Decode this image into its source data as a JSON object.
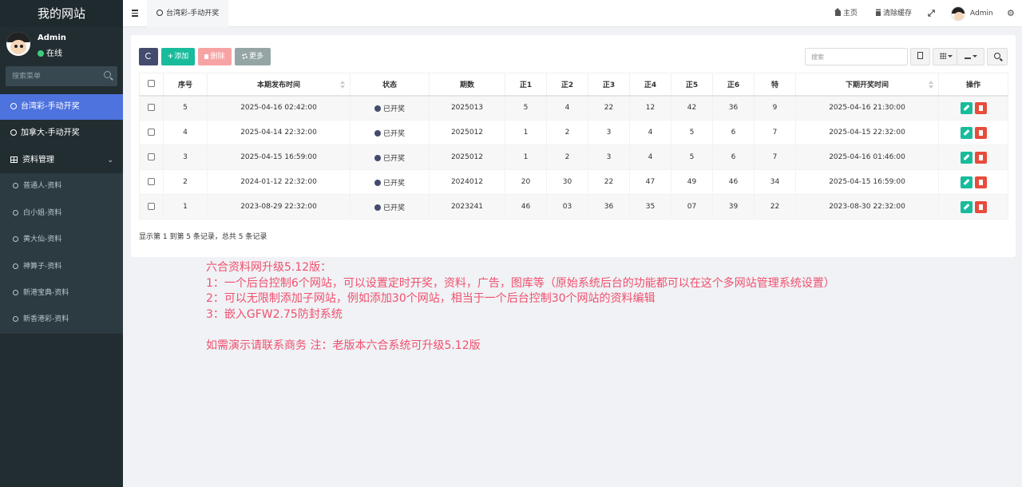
{
  "sidebar": {
    "logo": "我的网站",
    "user": {
      "name": "Admin",
      "status": "在线"
    },
    "search_placeholder": "搜索菜单",
    "items": [
      {
        "label": "台湾彩-手动开奖",
        "active": true
      },
      {
        "label": "加拿大-手动开奖",
        "active": false
      }
    ],
    "group": {
      "label": "资料管理",
      "children": [
        "普通人-资料",
        "白小姐-资料",
        "黄大仙-资料",
        "神算子-资料",
        "新港宝典-资料",
        "新香港彩-资料"
      ]
    }
  },
  "header": {
    "tab": "台湾彩-手动开奖",
    "home": "主页",
    "clear_cache": "清除缓存",
    "admin": "Admin"
  },
  "toolbar": {
    "add": "添加",
    "delete": "删除",
    "more": "更多",
    "search_placeholder": "搜索"
  },
  "table": {
    "columns": [
      "序号",
      "本期发布时间",
      "状态",
      "期数",
      "正1",
      "正2",
      "正3",
      "正4",
      "正5",
      "正6",
      "特",
      "下期开奖时间",
      "操作"
    ],
    "rows": [
      [
        "5",
        "2025-04-16 02:42:00",
        "已开奖",
        "2025013",
        "5",
        "4",
        "22",
        "12",
        "42",
        "36",
        "9",
        "2025-04-16 21:30:00"
      ],
      [
        "4",
        "2025-04-14 22:32:00",
        "已开奖",
        "2025012",
        "1",
        "2",
        "3",
        "4",
        "5",
        "6",
        "7",
        "2025-04-15 22:32:00"
      ],
      [
        "3",
        "2025-04-15 16:59:00",
        "已开奖",
        "2025012",
        "1",
        "2",
        "3",
        "4",
        "5",
        "6",
        "7",
        "2025-04-16 01:46:00"
      ],
      [
        "2",
        "2024-01-12 22:32:00",
        "已开奖",
        "2024012",
        "20",
        "30",
        "22",
        "47",
        "49",
        "46",
        "34",
        "2025-04-15 16:59:00"
      ],
      [
        "1",
        "2023-08-29 22:32:00",
        "已开奖",
        "2023241",
        "46",
        "03",
        "36",
        "35",
        "07",
        "39",
        "22",
        "2023-08-30 22:32:00"
      ]
    ],
    "pagination": "显示第 1 到第 5 条记录，总共 5 条记录"
  },
  "notice": {
    "color": "#f0506e",
    "lines": [
      "六合资料网升级5.12版：",
      "1：一个后台控制6个网站，可以设置定时开奖，资料，广告，图库等（原始系统后台的功能都可以在这个多网站管理系统设置）",
      "2：可以无限制添加子网站，例如添加30个网站，相当于一个后台控制30个网站的资料编辑",
      "3：嵌入GFW2.75防封系统",
      "",
      "如需演示请联系商务  注：老版本六合系统可升级5.12版"
    ]
  },
  "colors": {
    "sidebar_bg": "#222d32",
    "active_item": "#4e73df",
    "add_button": "#18bc9c",
    "delete_button": "#f7a3a3",
    "more_button": "#95a5a6",
    "refresh_button": "#444c6e",
    "edit_button": "#18bc9c",
    "remove_button": "#e74c3c"
  }
}
